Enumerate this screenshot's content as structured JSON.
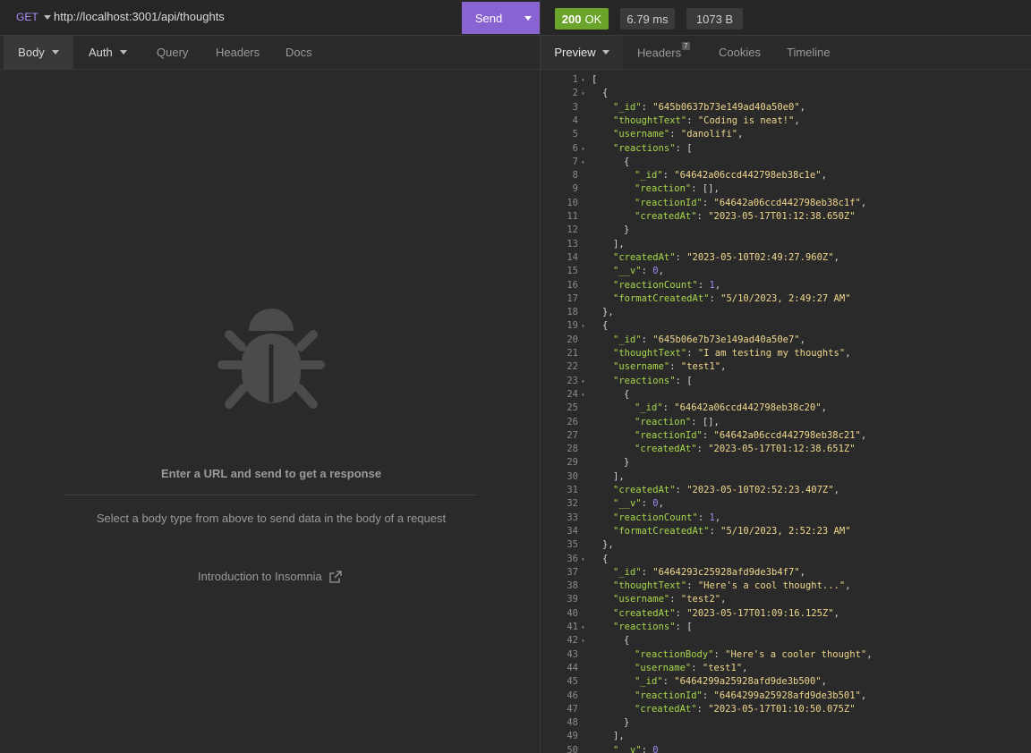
{
  "request": {
    "method": "GET",
    "url": "http://localhost:3001/api/thoughts",
    "send_label": "Send"
  },
  "request_tabs": [
    {
      "label": "Body",
      "dropdown": true,
      "active": true
    },
    {
      "label": "Auth",
      "dropdown": true,
      "active": false
    },
    {
      "label": "Query",
      "dropdown": false,
      "active": false
    },
    {
      "label": "Headers",
      "dropdown": false,
      "active": false
    },
    {
      "label": "Docs",
      "dropdown": false,
      "active": false
    }
  ],
  "empty_state": {
    "icon": "bug-icon",
    "title": "Enter a URL and send to get a response",
    "subtitle": "Select a body type from above to send data in the body of a request",
    "link": "Introduction to Insomnia"
  },
  "response": {
    "status": "200",
    "status_text": "OK",
    "time": "6.79 ms",
    "size": "1073 B",
    "status_color": "#6ba42a"
  },
  "response_tabs": [
    {
      "label": "Preview",
      "dropdown": true,
      "active": true
    },
    {
      "label": "Headers",
      "badge": "7",
      "active": false
    },
    {
      "label": "Cookies",
      "active": false
    },
    {
      "label": "Timeline",
      "active": false
    }
  ],
  "code_lines": [
    {
      "n": 1,
      "fold": true,
      "indent": 0,
      "tokens": [
        [
          "p",
          "["
        ]
      ]
    },
    {
      "n": 2,
      "fold": true,
      "indent": 1,
      "tokens": [
        [
          "p",
          "{"
        ]
      ]
    },
    {
      "n": 3,
      "indent": 2,
      "tokens": [
        [
          "k",
          "\"_id\""
        ],
        [
          "p",
          ": "
        ],
        [
          "s",
          "\"645b0637b73e149ad40a50e0\""
        ],
        [
          "p",
          ","
        ]
      ]
    },
    {
      "n": 4,
      "indent": 2,
      "tokens": [
        [
          "k",
          "\"thoughtText\""
        ],
        [
          "p",
          ": "
        ],
        [
          "s",
          "\"Coding is neat!\""
        ],
        [
          "p",
          ","
        ]
      ]
    },
    {
      "n": 5,
      "indent": 2,
      "tokens": [
        [
          "k",
          "\"username\""
        ],
        [
          "p",
          ": "
        ],
        [
          "s",
          "\"danolifi\""
        ],
        [
          "p",
          ","
        ]
      ]
    },
    {
      "n": 6,
      "fold": true,
      "indent": 2,
      "tokens": [
        [
          "k",
          "\"reactions\""
        ],
        [
          "p",
          ": ["
        ]
      ]
    },
    {
      "n": 7,
      "fold": true,
      "indent": 3,
      "tokens": [
        [
          "p",
          "{"
        ]
      ]
    },
    {
      "n": 8,
      "indent": 4,
      "tokens": [
        [
          "k",
          "\"_id\""
        ],
        [
          "p",
          ": "
        ],
        [
          "s",
          "\"64642a06ccd442798eb38c1e\""
        ],
        [
          "p",
          ","
        ]
      ]
    },
    {
      "n": 9,
      "indent": 4,
      "tokens": [
        [
          "k",
          "\"reaction\""
        ],
        [
          "p",
          ": [],"
        ]
      ]
    },
    {
      "n": 10,
      "indent": 4,
      "tokens": [
        [
          "k",
          "\"reactionId\""
        ],
        [
          "p",
          ": "
        ],
        [
          "s",
          "\"64642a06ccd442798eb38c1f\""
        ],
        [
          "p",
          ","
        ]
      ]
    },
    {
      "n": 11,
      "indent": 4,
      "tokens": [
        [
          "k",
          "\"createdAt\""
        ],
        [
          "p",
          ": "
        ],
        [
          "s",
          "\"2023-05-17T01:12:38.650Z\""
        ]
      ]
    },
    {
      "n": 12,
      "indent": 3,
      "tokens": [
        [
          "p",
          "}"
        ]
      ]
    },
    {
      "n": 13,
      "indent": 2,
      "tokens": [
        [
          "p",
          "],"
        ]
      ]
    },
    {
      "n": 14,
      "indent": 2,
      "tokens": [
        [
          "k",
          "\"createdAt\""
        ],
        [
          "p",
          ": "
        ],
        [
          "s",
          "\"2023-05-10T02:49:27.960Z\""
        ],
        [
          "p",
          ","
        ]
      ]
    },
    {
      "n": 15,
      "indent": 2,
      "tokens": [
        [
          "k",
          "\"__v\""
        ],
        [
          "p",
          ": "
        ],
        [
          "n",
          "0"
        ],
        [
          "p",
          ","
        ]
      ]
    },
    {
      "n": 16,
      "indent": 2,
      "tokens": [
        [
          "k",
          "\"reactionCount\""
        ],
        [
          "p",
          ": "
        ],
        [
          "n",
          "1"
        ],
        [
          "p",
          ","
        ]
      ]
    },
    {
      "n": 17,
      "indent": 2,
      "tokens": [
        [
          "k",
          "\"formatCreatedAt\""
        ],
        [
          "p",
          ": "
        ],
        [
          "s",
          "\"5/10/2023, 2:49:27 AM\""
        ]
      ]
    },
    {
      "n": 18,
      "indent": 1,
      "tokens": [
        [
          "p",
          "},"
        ]
      ]
    },
    {
      "n": 19,
      "fold": true,
      "indent": 1,
      "tokens": [
        [
          "p",
          "{"
        ]
      ]
    },
    {
      "n": 20,
      "indent": 2,
      "tokens": [
        [
          "k",
          "\"_id\""
        ],
        [
          "p",
          ": "
        ],
        [
          "s",
          "\"645b06e7b73e149ad40a50e7\""
        ],
        [
          "p",
          ","
        ]
      ]
    },
    {
      "n": 21,
      "indent": 2,
      "tokens": [
        [
          "k",
          "\"thoughtText\""
        ],
        [
          "p",
          ": "
        ],
        [
          "s",
          "\"I am testing my thoughts\""
        ],
        [
          "p",
          ","
        ]
      ]
    },
    {
      "n": 22,
      "indent": 2,
      "tokens": [
        [
          "k",
          "\"username\""
        ],
        [
          "p",
          ": "
        ],
        [
          "s",
          "\"test1\""
        ],
        [
          "p",
          ","
        ]
      ]
    },
    {
      "n": 23,
      "fold": true,
      "indent": 2,
      "tokens": [
        [
          "k",
          "\"reactions\""
        ],
        [
          "p",
          ": ["
        ]
      ]
    },
    {
      "n": 24,
      "fold": true,
      "indent": 3,
      "tokens": [
        [
          "p",
          "{"
        ]
      ]
    },
    {
      "n": 25,
      "indent": 4,
      "tokens": [
        [
          "k",
          "\"_id\""
        ],
        [
          "p",
          ": "
        ],
        [
          "s",
          "\"64642a06ccd442798eb38c20\""
        ],
        [
          "p",
          ","
        ]
      ]
    },
    {
      "n": 26,
      "indent": 4,
      "tokens": [
        [
          "k",
          "\"reaction\""
        ],
        [
          "p",
          ": [],"
        ]
      ]
    },
    {
      "n": 27,
      "indent": 4,
      "tokens": [
        [
          "k",
          "\"reactionId\""
        ],
        [
          "p",
          ": "
        ],
        [
          "s",
          "\"64642a06ccd442798eb38c21\""
        ],
        [
          "p",
          ","
        ]
      ]
    },
    {
      "n": 28,
      "indent": 4,
      "tokens": [
        [
          "k",
          "\"createdAt\""
        ],
        [
          "p",
          ": "
        ],
        [
          "s",
          "\"2023-05-17T01:12:38.651Z\""
        ]
      ]
    },
    {
      "n": 29,
      "indent": 3,
      "tokens": [
        [
          "p",
          "}"
        ]
      ]
    },
    {
      "n": 30,
      "indent": 2,
      "tokens": [
        [
          "p",
          "],"
        ]
      ]
    },
    {
      "n": 31,
      "indent": 2,
      "tokens": [
        [
          "k",
          "\"createdAt\""
        ],
        [
          "p",
          ": "
        ],
        [
          "s",
          "\"2023-05-10T02:52:23.407Z\""
        ],
        [
          "p",
          ","
        ]
      ]
    },
    {
      "n": 32,
      "indent": 2,
      "tokens": [
        [
          "k",
          "\"__v\""
        ],
        [
          "p",
          ": "
        ],
        [
          "n",
          "0"
        ],
        [
          "p",
          ","
        ]
      ]
    },
    {
      "n": 33,
      "indent": 2,
      "tokens": [
        [
          "k",
          "\"reactionCount\""
        ],
        [
          "p",
          ": "
        ],
        [
          "n",
          "1"
        ],
        [
          "p",
          ","
        ]
      ]
    },
    {
      "n": 34,
      "indent": 2,
      "tokens": [
        [
          "k",
          "\"formatCreatedAt\""
        ],
        [
          "p",
          ": "
        ],
        [
          "s",
          "\"5/10/2023, 2:52:23 AM\""
        ]
      ]
    },
    {
      "n": 35,
      "indent": 1,
      "tokens": [
        [
          "p",
          "},"
        ]
      ]
    },
    {
      "n": 36,
      "fold": true,
      "indent": 1,
      "tokens": [
        [
          "p",
          "{"
        ]
      ]
    },
    {
      "n": 37,
      "indent": 2,
      "tokens": [
        [
          "k",
          "\"_id\""
        ],
        [
          "p",
          ": "
        ],
        [
          "s",
          "\"6464293c25928afd9de3b4f7\""
        ],
        [
          "p",
          ","
        ]
      ]
    },
    {
      "n": 38,
      "indent": 2,
      "tokens": [
        [
          "k",
          "\"thoughtText\""
        ],
        [
          "p",
          ": "
        ],
        [
          "s",
          "\"Here's a cool thought...\""
        ],
        [
          "p",
          ","
        ]
      ]
    },
    {
      "n": 39,
      "indent": 2,
      "tokens": [
        [
          "k",
          "\"username\""
        ],
        [
          "p",
          ": "
        ],
        [
          "s",
          "\"test2\""
        ],
        [
          "p",
          ","
        ]
      ]
    },
    {
      "n": 40,
      "indent": 2,
      "tokens": [
        [
          "k",
          "\"createdAt\""
        ],
        [
          "p",
          ": "
        ],
        [
          "s",
          "\"2023-05-17T01:09:16.125Z\""
        ],
        [
          "p",
          ","
        ]
      ]
    },
    {
      "n": 41,
      "fold": true,
      "indent": 2,
      "tokens": [
        [
          "k",
          "\"reactions\""
        ],
        [
          "p",
          ": ["
        ]
      ]
    },
    {
      "n": 42,
      "fold": true,
      "indent": 3,
      "tokens": [
        [
          "p",
          "{"
        ]
      ]
    },
    {
      "n": 43,
      "indent": 4,
      "tokens": [
        [
          "k",
          "\"reactionBody\""
        ],
        [
          "p",
          ": "
        ],
        [
          "s",
          "\"Here's a cooler thought\""
        ],
        [
          "p",
          ","
        ]
      ]
    },
    {
      "n": 44,
      "indent": 4,
      "tokens": [
        [
          "k",
          "\"username\""
        ],
        [
          "p",
          ": "
        ],
        [
          "s",
          "\"test1\""
        ],
        [
          "p",
          ","
        ]
      ]
    },
    {
      "n": 45,
      "indent": 4,
      "tokens": [
        [
          "k",
          "\"_id\""
        ],
        [
          "p",
          ": "
        ],
        [
          "s",
          "\"6464299a25928afd9de3b500\""
        ],
        [
          "p",
          ","
        ]
      ]
    },
    {
      "n": 46,
      "indent": 4,
      "tokens": [
        [
          "k",
          "\"reactionId\""
        ],
        [
          "p",
          ": "
        ],
        [
          "s",
          "\"6464299a25928afd9de3b501\""
        ],
        [
          "p",
          ","
        ]
      ]
    },
    {
      "n": 47,
      "indent": 4,
      "tokens": [
        [
          "k",
          "\"createdAt\""
        ],
        [
          "p",
          ": "
        ],
        [
          "s",
          "\"2023-05-17T01:10:50.075Z\""
        ]
      ]
    },
    {
      "n": 48,
      "indent": 3,
      "tokens": [
        [
          "p",
          "}"
        ]
      ]
    },
    {
      "n": 49,
      "indent": 2,
      "tokens": [
        [
          "p",
          "],"
        ]
      ]
    },
    {
      "n": 50,
      "indent": 2,
      "tokens": [
        [
          "k",
          "\"__v\""
        ],
        [
          "p",
          ": "
        ],
        [
          "n",
          "0"
        ]
      ]
    }
  ]
}
